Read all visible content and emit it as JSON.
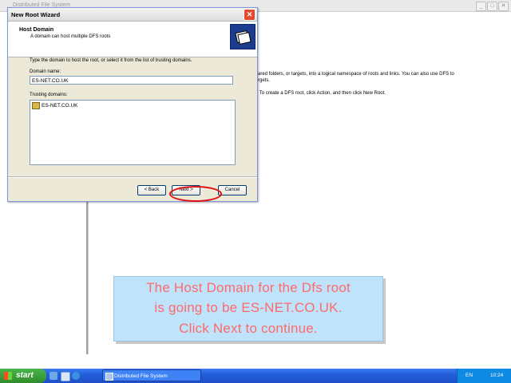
{
  "background_window": {
    "title": "Distributed File System",
    "controls": [
      "_",
      "□",
      "✕"
    ],
    "right_pane_lines": [
      "ared folders, or targets, into a logical namespace of roots and links. You can also use DFS to",
      "rgets.",
      "t. To create a DFS root, click Action, and then click New Root."
    ]
  },
  "wizard": {
    "title": "New Root Wizard",
    "close_label": "✕",
    "header_title": "Host Domain",
    "header_subtitle": "A domain can host multiple DFS roots",
    "instruction": "Type the domain to host the root, or select it from the list of trusting domains.",
    "domain_label": "Domain name:",
    "domain_value": "ES-NET.CO.UK",
    "trusting_label": "Trusting domains:",
    "trusting_items": [
      "ES-NET.CO.UK"
    ],
    "back_label": "< Back",
    "next_label": "Next >",
    "cancel_label": "Cancel"
  },
  "caption": {
    "lines": [
      "The Host Domain for the Dfs root",
      "is going to be ES-NET.CO.UK.",
      "Click Next to continue."
    ]
  },
  "taskbar": {
    "start_label": "start",
    "task_label": "Distributed File System",
    "language": "EN",
    "time": "10:24"
  },
  "colors": {
    "highlight_ring": "#e01010",
    "caption_bg": "#bfe3fb",
    "caption_text": "#ff6a6a",
    "taskbar": "#245edb"
  }
}
